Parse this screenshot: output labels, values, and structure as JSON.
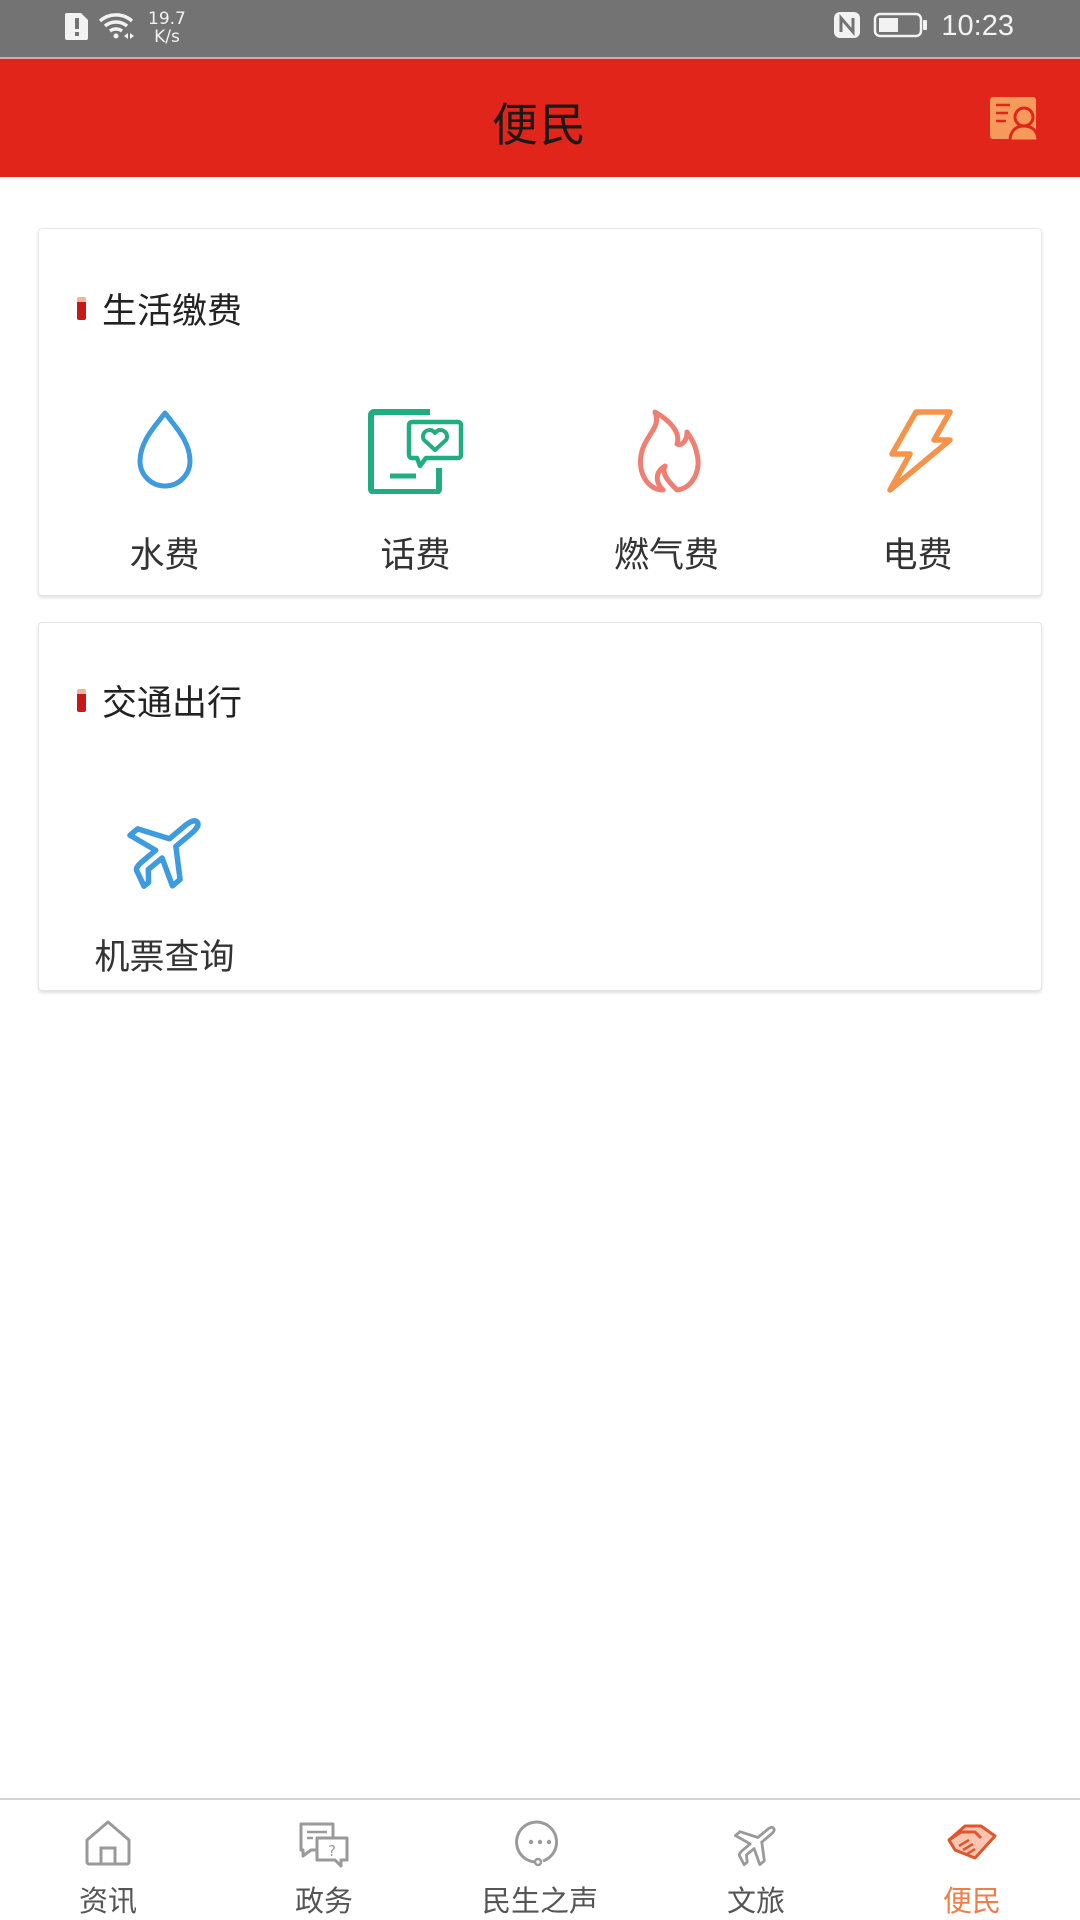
{
  "status_bar": {
    "network_speed_value": "19.7",
    "network_speed_unit": "K/s",
    "time": "10:23",
    "icons": [
      "sim-alert-icon",
      "wifi-icon",
      "nfc-icon",
      "battery-icon"
    ]
  },
  "header": {
    "title": "便民",
    "right_button_icon": "contact-card-icon"
  },
  "sections": [
    {
      "title": "生活缴费",
      "items": [
        {
          "label": "水费",
          "icon": "water-drop-icon",
          "color": "#3f9be0"
        },
        {
          "label": "话费",
          "icon": "phone-message-icon",
          "color": "#20ad82"
        },
        {
          "label": "燃气费",
          "icon": "flame-icon",
          "color": "#ee7f72"
        },
        {
          "label": "电费",
          "icon": "lightning-icon",
          "color": "#f6934a"
        }
      ]
    },
    {
      "title": "交通出行",
      "items": [
        {
          "label": "机票查询",
          "icon": "airplane-icon",
          "color": "#3f9be0"
        }
      ]
    }
  ],
  "bottom_nav": {
    "active_index": 4,
    "active_color": "#ef7f4a",
    "items": [
      {
        "label": "资讯",
        "icon": "home-icon"
      },
      {
        "label": "政务",
        "icon": "consult-icon"
      },
      {
        "label": "民生之声",
        "icon": "chat-bubble-icon"
      },
      {
        "label": "文旅",
        "icon": "airplane-icon"
      },
      {
        "label": "便民",
        "icon": "handshake-icon"
      }
    ]
  },
  "colors": {
    "header_bg": "#e1251b",
    "status_bar_bg": "#737373",
    "section_marker": "#c9181a"
  }
}
